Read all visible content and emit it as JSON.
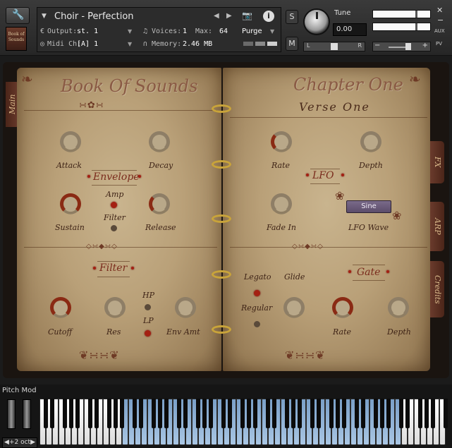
{
  "header": {
    "instrument_title": "Choir - Perfection",
    "output_label": "Output:",
    "output_value": "st. 1",
    "midi_label": "Midi Ch:",
    "midi_value": "[A] 1",
    "voices_label": "Voices:",
    "voices_value": "1",
    "max_label": "Max:",
    "max_value": "64",
    "memory_label": "Memory:",
    "memory_value": "2.46 MB",
    "purge_label": "Purge",
    "solo_label": "S",
    "mute_label": "M",
    "tune_label": "Tune",
    "tune_value": "0.00",
    "pan_left": "L",
    "pan_right": "R",
    "aux_label": "AUX",
    "pv_label": "PV",
    "thumbnail_text": "Book of Sounds"
  },
  "left_page": {
    "title": "Book Of Sounds",
    "envelope": {
      "section_title": "Envelope",
      "attack_label": "Attack",
      "decay_label": "Decay",
      "sustain_label": "Sustain",
      "release_label": "Release",
      "amp_label": "Amp",
      "filter_label": "Filter"
    },
    "filter": {
      "section_title": "Filter",
      "cutoff_label": "Cutoff",
      "res_label": "Res",
      "env_amt_label": "Env Amt",
      "hp_label": "HP",
      "lp_label": "LP"
    }
  },
  "right_page": {
    "title": "Chapter One",
    "subtitle": "Verse One",
    "lfo": {
      "section_title": "LFO",
      "rate_label": "Rate",
      "depth_label": "Depth",
      "fade_in_label": "Fade In",
      "wave_label": "LFO Wave",
      "wave_value": "Sine"
    },
    "gate": {
      "section_title": "Gate",
      "legato_label": "Legato",
      "glide_label": "Glide",
      "regular_label": "Regular",
      "rate_label": "Rate",
      "depth_label": "Depth"
    }
  },
  "tabs": {
    "main": "Main",
    "fx": "FX",
    "arp": "ARP",
    "credits": "Credits"
  },
  "keyboard": {
    "pitch_mod_label": "Pitch Mod",
    "octave_label": "+2 oct"
  },
  "colors": {
    "parchment": "#c9b48e",
    "accent_red": "#a42012",
    "ink": "#6b3a28",
    "ring_gold": "#c9a43a"
  }
}
